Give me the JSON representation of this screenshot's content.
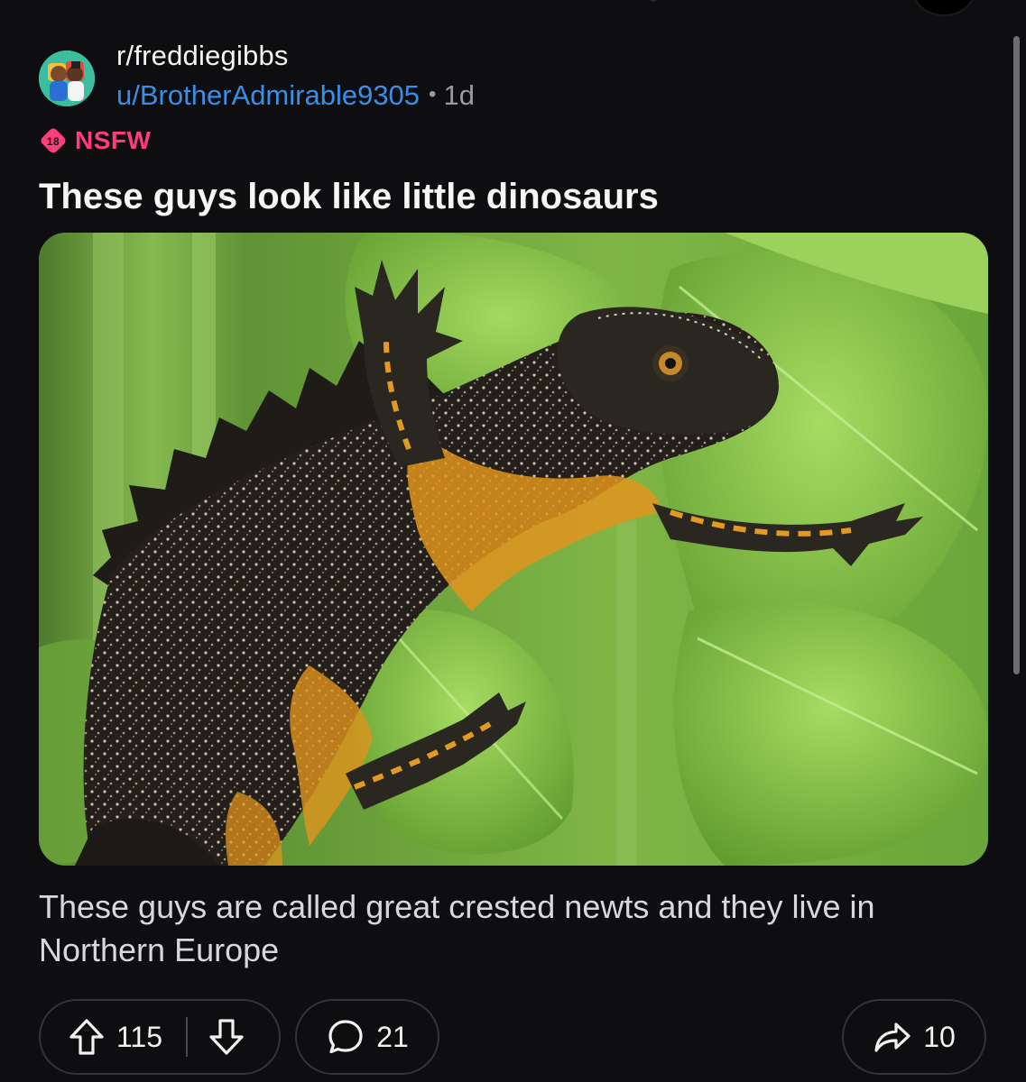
{
  "post": {
    "subreddit": "r/freddiegibbs",
    "username": "u/BrotherAdmirable9305",
    "separator": "•",
    "age": "1d",
    "nsfw_badge": "18",
    "nsfw_label": "NSFW",
    "title": "These guys look like little dinosaurs",
    "body": "These guys are called great crested newts and they live in Northern Europe",
    "image_subject": "great-crested-newt-photo"
  },
  "actions": {
    "upvotes": "115",
    "comments": "21",
    "shares": "10"
  },
  "colors": {
    "background": "#0e0e10",
    "username": "#3a8ee6",
    "nsfw": "#ff3d7d",
    "pill_border": "#343438"
  }
}
